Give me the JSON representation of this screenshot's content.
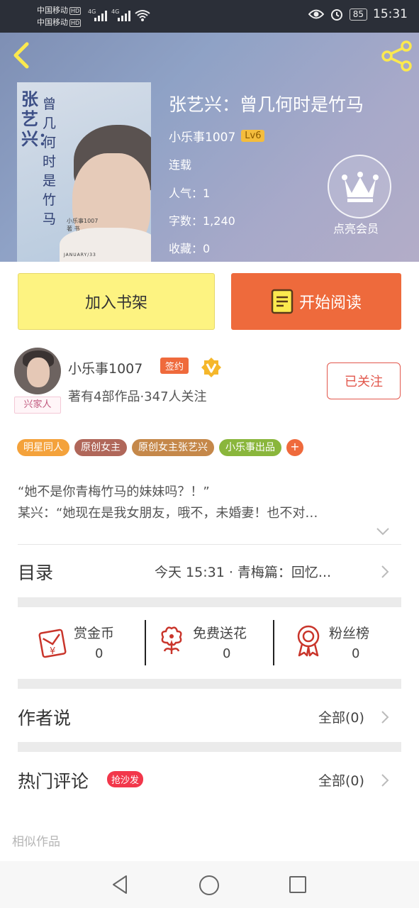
{
  "status_bar": {
    "carrier1": "中国移动",
    "carrier2": "中国移动",
    "hd": "HD",
    "network": "4G",
    "battery": "85",
    "time": "15:31"
  },
  "book": {
    "title": "张艺兴：曾几何时是竹马",
    "author": "小乐事1007",
    "level": "Lv6",
    "status": "连载",
    "popularity": "人气：1",
    "word_count": "字数：1,240",
    "favorites": "收藏：0",
    "vip_label": "点亮会员",
    "cover_title1": "张艺兴：",
    "cover_title2": [
      "曾",
      "几",
      "何",
      "时",
      "是",
      "竹",
      "马"
    ],
    "cover_author": "小乐事1007",
    "cover_author_sub": "著 书",
    "cover_date": "JANUARY/33"
  },
  "actions": {
    "add_shelf": "加入书架",
    "start_reading": "开始阅读"
  },
  "author": {
    "name": "小乐事1007",
    "sign_badge": "签约",
    "fan_tag": "兴家人",
    "stats": "著有4部作品·347人关注",
    "follow_label": "已关注"
  },
  "tags": [
    {
      "label": "明星同人",
      "color": "#f4a23b"
    },
    {
      "label": "原创女主",
      "color": "#b0675a"
    },
    {
      "label": "原创女主张艺兴",
      "color": "#c5884a"
    },
    {
      "label": "小乐事出品",
      "color": "#8ab63c"
    }
  ],
  "tag_more": "+",
  "intro": {
    "line1": "“她不是你青梅竹马的妹妹吗？！”",
    "line2": "某兴：“她现在是我女朋友，哦不，未婚妻！也不对…"
  },
  "catalog": {
    "title": "目录",
    "latest": "今天 15:31 · 青梅篇：回忆..."
  },
  "rewards": [
    {
      "label": "赏金币",
      "count": "0",
      "icon": "red-envelope-icon"
    },
    {
      "label": "免费送花",
      "count": "0",
      "icon": "flower-icon"
    },
    {
      "label": "粉丝榜",
      "count": "0",
      "icon": "medal-icon"
    }
  ],
  "author_says": {
    "title": "作者说",
    "all": "全部(0)"
  },
  "hot_comments": {
    "title": "热门评论",
    "badge": "抢沙发",
    "all": "全部(0)"
  },
  "similar_works": "相似作品",
  "colors": {
    "accent_orange": "#ee6a3c",
    "shelf_yellow": "#fdf381",
    "follow_red": "#e2574c",
    "hot_red": "#f2374b"
  }
}
